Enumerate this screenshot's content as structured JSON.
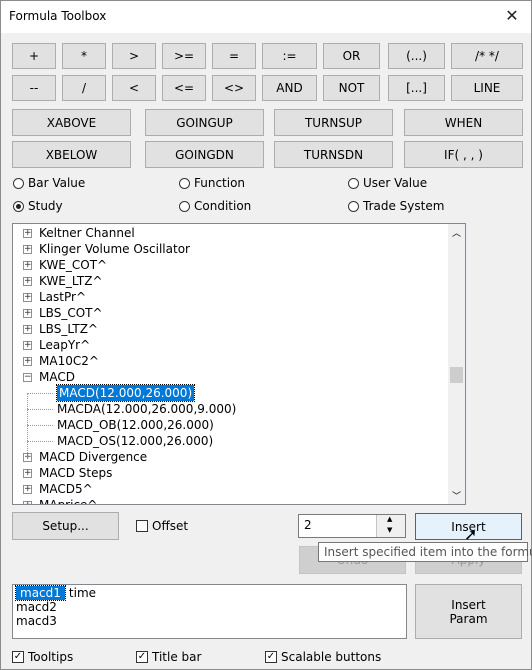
{
  "window": {
    "title": "Formula Toolbox",
    "close_glyph": "✕"
  },
  "operators": {
    "row1": [
      "+",
      "*",
      ">",
      ">=",
      "=",
      ":=",
      "OR",
      "(...)",
      "/* */"
    ],
    "row2": [
      "--",
      "/",
      "<",
      "<=",
      "<>",
      "AND",
      "NOT",
      "[...]",
      "LINE"
    ]
  },
  "functions": {
    "row1": [
      "XABOVE",
      "GOINGUP",
      "TURNSUP",
      "WHEN"
    ],
    "row2": [
      "XBELOW",
      "GOINGDN",
      "TURNSDN",
      "IF( , , )"
    ]
  },
  "item_types": [
    {
      "label": "Bar Value",
      "checked": false
    },
    {
      "label": "Function",
      "checked": false
    },
    {
      "label": "User Value",
      "checked": false
    },
    {
      "label": "Study",
      "checked": true
    },
    {
      "label": "Condition",
      "checked": false
    },
    {
      "label": "Trade System",
      "checked": false
    }
  ],
  "tree": {
    "items": [
      {
        "label": "Keltner Channel",
        "level": 0,
        "expander": "+"
      },
      {
        "label": "Klinger Volume Oscillator",
        "level": 0,
        "expander": "+"
      },
      {
        "label": "KWE_COT^",
        "level": 0,
        "expander": "+"
      },
      {
        "label": "KWE_LTZ^",
        "level": 0,
        "expander": "+"
      },
      {
        "label": "LastPr^",
        "level": 0,
        "expander": "+"
      },
      {
        "label": "LBS_COT^",
        "level": 0,
        "expander": "+"
      },
      {
        "label": "LBS_LTZ^",
        "level": 0,
        "expander": "+"
      },
      {
        "label": "LeapYr^",
        "level": 0,
        "expander": "+"
      },
      {
        "label": "MA10C2^",
        "level": 0,
        "expander": "+"
      },
      {
        "label": "MACD",
        "level": 0,
        "expander": "-"
      },
      {
        "label": "MACD(12.000,26.000)",
        "level": 1,
        "expander": "",
        "selected": true
      },
      {
        "label": "MACDA(12.000,26.000,9.000)",
        "level": 1,
        "expander": ""
      },
      {
        "label": "MACD_OB(12.000,26.000)",
        "level": 1,
        "expander": ""
      },
      {
        "label": "MACD_OS(12.000,26.000)",
        "level": 1,
        "expander": ""
      },
      {
        "label": "MACD Divergence",
        "level": 0,
        "expander": "+"
      },
      {
        "label": "MACD Steps",
        "level": 0,
        "expander": "+"
      },
      {
        "label": "MACD5^",
        "level": 0,
        "expander": "+"
      },
      {
        "label": "MAprice^",
        "level": 0,
        "expander": "+"
      }
    ],
    "scroll_position": 0.55
  },
  "controls": {
    "setup_label": "Setup...",
    "offset_label": "Offset",
    "offset_checked": false,
    "spin_value": "2",
    "insert_label": "Insert",
    "undo_label": "Undo",
    "apply_label": "Apply",
    "tooltip_text": "Insert specified item into the formula",
    "insert_param_label": "Insert\nParam"
  },
  "params": [
    {
      "name": "macd1",
      "desc": "time",
      "selected": true
    },
    {
      "name": "macd2",
      "desc": ""
    },
    {
      "name": "macd3",
      "desc": ""
    }
  ],
  "options": [
    {
      "label": "Tooltips",
      "checked": true
    },
    {
      "label": "Title bar",
      "checked": true
    },
    {
      "label": "Scalable buttons",
      "checked": true
    }
  ]
}
